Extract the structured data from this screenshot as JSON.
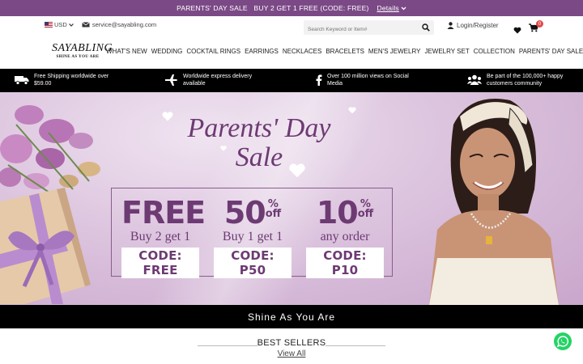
{
  "promo": {
    "text": "PARENTS' DAY SALE   BUY 2 GET 1 FREE (CODE: FREE)",
    "details": "Details"
  },
  "util": {
    "currency": "USD",
    "email": "service@sayabling.com",
    "search_placeholder": "Search Keyword or Item#",
    "login": "Login/Register",
    "cart_count": "0"
  },
  "logo": {
    "main": "SAYABLING",
    "sub": "SHINE AS YOU ARE"
  },
  "nav": [
    "WHAT'S NEW",
    "WEDDING",
    "COCKTAIL RINGS",
    "EARRINGS",
    "NECKLACES",
    "BRACELETS",
    "MEN'S JEWELRY",
    "JEWELRY SET",
    "COLLECTION",
    "PARENTS' DAY SALE"
  ],
  "features": [
    {
      "icon": "truck-icon",
      "text": "Free Shipping worldwide over $59.00"
    },
    {
      "icon": "airplane-icon",
      "text": "Worldwide express delivery available"
    },
    {
      "icon": "facebook-icon",
      "text": "Over 100 million views on Social Media"
    },
    {
      "icon": "community-icon",
      "text": "Be part of the 100,000+ happy customers community"
    }
  ],
  "hero": {
    "title_1": "Parents' Day",
    "title_2": "Sale",
    "offers": [
      {
        "big": "FREE",
        "off": "",
        "sub": "Buy 2 get 1",
        "code": "CODE: FREE"
      },
      {
        "big": "50",
        "off": "%\noff",
        "sub": "Buy 1 get 1",
        "code": "CODE: P50"
      },
      {
        "big": "10",
        "off": "%\noff",
        "sub": "any order",
        "code": "CODE: P10"
      }
    ]
  },
  "tagline": "Shine As You Are",
  "bestsellers": {
    "title": "BEST SELLERS",
    "link": "View All"
  },
  "colors": {
    "brand_purple": "#7b4a86",
    "hero_text": "#6d3a73",
    "whatsapp": "#25d366"
  }
}
